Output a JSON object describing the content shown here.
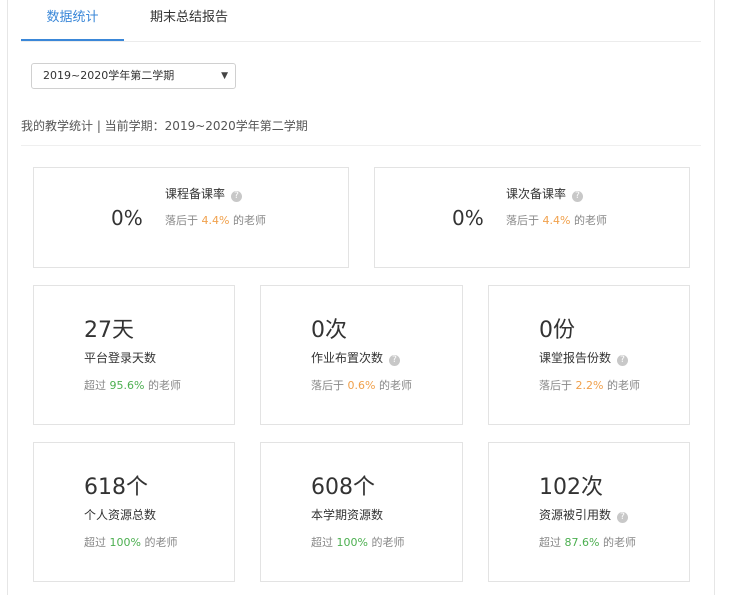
{
  "tabs": [
    {
      "label": "数据统计",
      "active": true
    },
    {
      "label": "期末总结报告",
      "active": false
    }
  ],
  "semester_select": {
    "value": "2019~2020学年第二学期"
  },
  "summary": {
    "text": "我的教学统计 | 当前学期：2019~2020学年第二学期"
  },
  "top_cards": [
    {
      "value": "0%",
      "label": "课程备课率",
      "sub_prefix": "落后于 ",
      "sub_value": "4.4%",
      "sub_suffix": " 的老师"
    },
    {
      "value": "0%",
      "label": "课次备课率",
      "sub_prefix": "落后于 ",
      "sub_value": "4.4%",
      "sub_suffix": " 的老师"
    }
  ],
  "stat_cards": [
    {
      "value": "27天",
      "label": "平台登录天数",
      "sub_prefix": "超过 ",
      "sub_value": "95.6%",
      "sub_suffix": " 的老师",
      "help": false,
      "tone": "green"
    },
    {
      "value": "0次",
      "label": "作业布置次数",
      "sub_prefix": "落后于 ",
      "sub_value": "0.6%",
      "sub_suffix": " 的老师",
      "help": true,
      "tone": "orange"
    },
    {
      "value": "0份",
      "label": "课堂报告份数",
      "sub_prefix": "落后于 ",
      "sub_value": "2.2%",
      "sub_suffix": " 的老师",
      "help": true,
      "tone": "orange"
    },
    {
      "value": "618个",
      "label": "个人资源总数",
      "sub_prefix": "超过 ",
      "sub_value": "100%",
      "sub_suffix": " 的老师",
      "help": false,
      "tone": "green"
    },
    {
      "value": "608个",
      "label": "本学期资源数",
      "sub_prefix": "超过 ",
      "sub_value": "100%",
      "sub_suffix": " 的老师",
      "help": false,
      "tone": "green"
    },
    {
      "value": "102次",
      "label": "资源被引用数",
      "sub_prefix": "超过 ",
      "sub_value": "87.6%",
      "sub_suffix": " 的老师",
      "help": true,
      "tone": "green"
    }
  ],
  "help_glyph": "?",
  "icons": {
    "help": "question-circle-icon",
    "caret": "caret-down-icon"
  },
  "colors": {
    "accent": "#3a87d8",
    "behind": "#f0a04b",
    "ahead": "#4caf50"
  }
}
